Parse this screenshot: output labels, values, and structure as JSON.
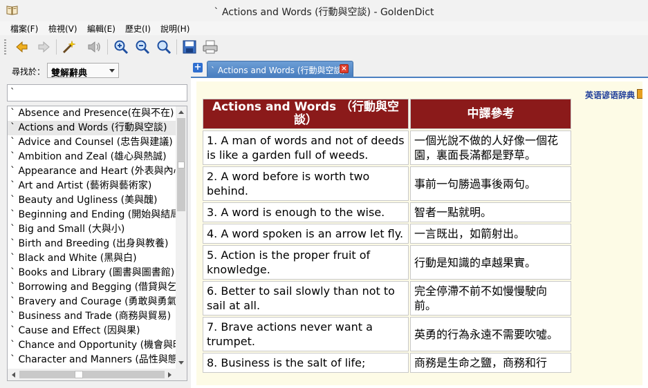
{
  "window": {
    "title": "` Actions and Words (行動與空談) - GoldenDict"
  },
  "menu": [
    {
      "label": "檔案(F)"
    },
    {
      "label": "檢視(V)"
    },
    {
      "label": "編輯(E)"
    },
    {
      "label": "歷史(I)"
    },
    {
      "label": "說明(H)"
    }
  ],
  "toolbar": {
    "icons": [
      "back-icon",
      "forward-icon",
      "scan-wand-icon",
      "pronounce-speaker-icon",
      "zoom-in-icon",
      "zoom-out-icon",
      "zoom-reset-icon",
      "save-icon",
      "print-icon"
    ]
  },
  "lookup": {
    "label": "尋找於：",
    "group": "雙解辭典",
    "search_value": "`"
  },
  "wordlist": [
    "` Absence and Presence(在與不在)",
    "` Actions and Words (行動與空談)",
    "` Advice and Counsel (忠告與建議)",
    "` Ambition and Zeal (雄心與熱誠)",
    "` Appearance and Heart (外表與內心)",
    "` Art and Artist (藝術與藝術家)",
    "` Beauty and Ugliness (美與醜)",
    "` Beginning and Ending (開始與結局)",
    "` Big and Small (大與小)",
    "` Birth and Breeding (出身與教養)",
    "` Black and White (黑與白)",
    "` Books and Library (圖書與圖書館)",
    "` Borrowing and Begging (借貸與乞討)",
    "` Bravery and Courage (勇敢與勇氣)",
    "` Business and Trade (商務與貿易)",
    "` Cause and Effect (因與果)",
    "` Chance and Opportunity (機會與時機)",
    "` Character and Manners (品性與態度)"
  ],
  "wordlist_selected": 1,
  "tab": {
    "title": "` Actions and Words (行動與空談)"
  },
  "article": {
    "dict_name": "英语谚语辞典",
    "header_en": "Actions and Words （行動與空談）",
    "header_zh": "中譯參考",
    "rows": [
      {
        "en": "1. A man of words and not of deeds is like a garden full of weeds.",
        "zh": "一個光說不做的人好像一個花園，裏面長滿都是野草。"
      },
      {
        "en": "2. A word before is worth two behind.",
        "zh": "事前一句勝過事後兩句。"
      },
      {
        "en": "3. A word is enough to the wise.",
        "zh": "智者一點就明。"
      },
      {
        "en": "4. A word spoken is an arrow let fly.",
        "zh": "一言既出，如箭射出。"
      },
      {
        "en": "5. Action is the proper fruit of knowledge.",
        "zh": "行動是知識的卓越果實。"
      },
      {
        "en": "6. Better to sail slowly than not to sail at all.",
        "zh": "完全停滯不前不如慢慢駛向前。"
      },
      {
        "en": "7. Brave actions never want a trumpet.",
        "zh": "英勇的行為永遠不需要吹噓。"
      },
      {
        "en": "8. Business is the salt of life;",
        "zh": "商務是生命之鹽，商務和行"
      }
    ]
  },
  "colors": {
    "header_bg": "#8b1a1a",
    "article_bg": "#fdfbe6",
    "tab_bg": "#5a8fcf"
  }
}
